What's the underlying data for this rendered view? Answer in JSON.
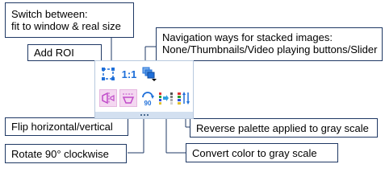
{
  "callouts": {
    "switch": [
      "Switch between:",
      "fit to window & real size"
    ],
    "navigation": [
      "Navigation ways for stacked images:",
      "None/Thumbnails/Video playing buttons/Slider"
    ],
    "add_roi": "Add ROI",
    "flip": "Flip horizontal/vertical",
    "rotate": "Rotate 90° clockwise",
    "reverse_palette": "Reverse palette applied to gray scale",
    "convert_gray": "Convert color to gray scale"
  },
  "toolbar": {
    "real_size_label": "1:1",
    "rotate_label": "90",
    "icons": [
      "roi-icon",
      "fit-real-size-icon",
      "stack-navigation-icon",
      "flip-horizontal-icon",
      "flip-vertical-icon",
      "rotate-90-icon",
      "color-to-gray-icon",
      "reverse-palette-icon"
    ],
    "colors": {
      "icon_blue": "#1e6fd9",
      "active_pink": "#f4d7f1",
      "flip_magenta": "#c04ac9",
      "grip": "#d3e0f0",
      "callout_border": "#1f3864"
    }
  }
}
